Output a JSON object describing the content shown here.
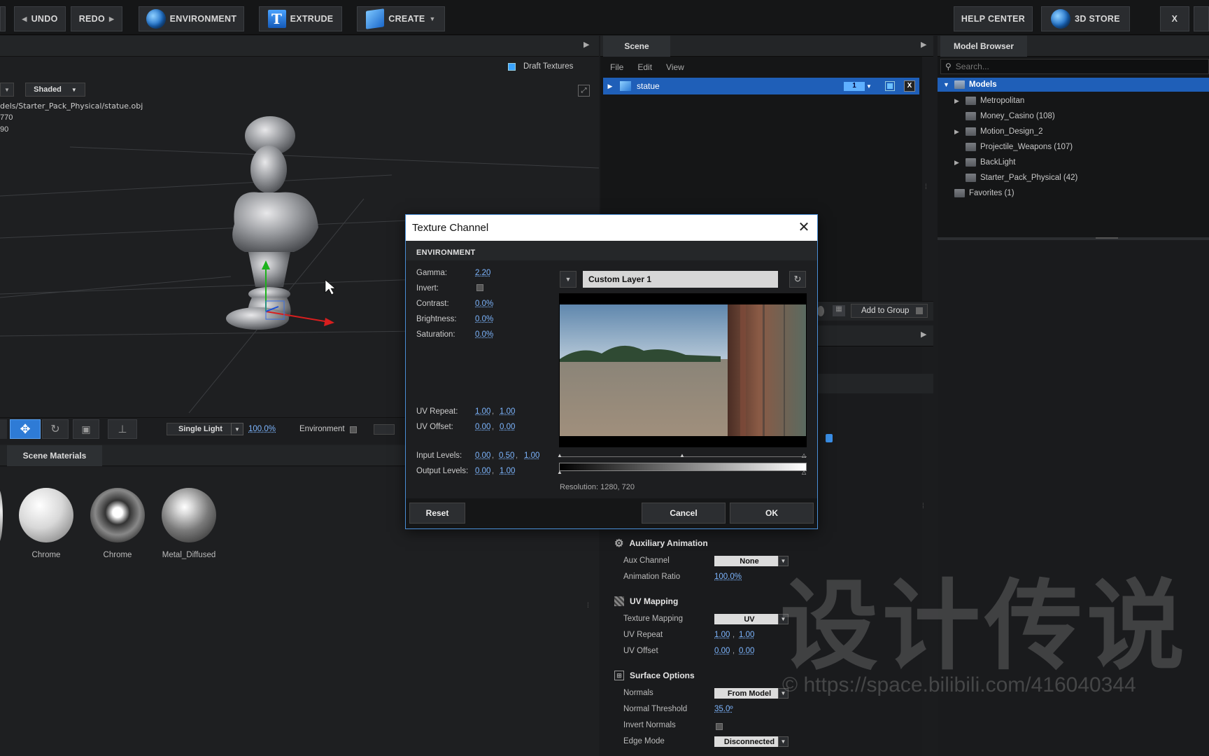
{
  "toolbar": {
    "undo": "UNDO",
    "redo": "REDO",
    "environment": "ENVIRONMENT",
    "extrude": "EXTRUDE",
    "create": "CREATE",
    "help_center": "HELP CENTER",
    "store": "3D STORE",
    "close": "X"
  },
  "viewport": {
    "draft_textures": "Draft Textures",
    "shading_mode": "Shaded",
    "file_path": "dels/Starter_Pack_Physical/statue.obj",
    "info_line1": "770",
    "info_line2": "90",
    "light_mode": "Single Light",
    "light_percent": "100.0%",
    "environment_label": "Environment"
  },
  "materials": {
    "tab": "Scene Materials",
    "items": [
      {
        "label": "Chrome"
      },
      {
        "label": "Chrome"
      },
      {
        "label": "Metal_Diffused"
      }
    ]
  },
  "scene": {
    "tab": "Scene",
    "menu": [
      "File",
      "Edit",
      "View"
    ],
    "object_name": "statue",
    "layer_number": "1",
    "add_to_group": "Add to Group"
  },
  "model_browser": {
    "tab": "Model Browser",
    "search_placeholder": "Search...",
    "root": "Models",
    "items": [
      {
        "label": "Metropolitan",
        "expandable": true
      },
      {
        "label": "Money_Casino (108)",
        "expandable": false
      },
      {
        "label": "Motion_Design_2",
        "expandable": true
      },
      {
        "label": "Projectile_Weapons (107)",
        "expandable": false
      },
      {
        "label": "BackLight",
        "expandable": true
      },
      {
        "label": "Starter_Pack_Physical (42)",
        "expandable": false
      }
    ],
    "favorites": "Favorites (1)"
  },
  "properties": {
    "aux_title": "Auxiliary Animation",
    "aux_channel_label": "Aux Channel",
    "aux_channel_value": "None",
    "anim_ratio_label": "Animation Ratio",
    "anim_ratio_value": "100.0%",
    "uv_title": "UV Mapping",
    "tex_mapping_label": "Texture Mapping",
    "tex_mapping_value": "UV",
    "uv_repeat_label": "UV Repeat",
    "uv_repeat_u": "1.00",
    "uv_repeat_v": "1.00",
    "uv_offset_label": "UV Offset",
    "uv_offset_u": "0.00",
    "uv_offset_v": "0.00",
    "surface_title": "Surface Options",
    "normals_label": "Normals",
    "normals_value": "From Model",
    "normal_threshold_label": "Normal Threshold",
    "normal_threshold_value": "35.0º",
    "invert_normals_label": "Invert Normals",
    "edge_mode_label": "Edge Mode",
    "edge_mode_value": "Disconnected"
  },
  "dialog": {
    "title": "Texture Channel",
    "section": "ENVIRONMENT",
    "gamma_label": "Gamma:",
    "gamma_value": "2.20",
    "invert_label": "Invert:",
    "contrast_label": "Contrast:",
    "contrast_value": "0.0%",
    "brightness_label": "Brightness:",
    "brightness_value": "0.0%",
    "saturation_label": "Saturation:",
    "saturation_value": "0.0%",
    "uv_repeat_label": "UV Repeat:",
    "uv_repeat_u": "1.00",
    "uv_repeat_v": "1.00",
    "uv_offset_label": "UV Offset:",
    "uv_offset_u": "0.00",
    "uv_offset_v": "0.00",
    "input_levels_label": "Input Levels:",
    "input_levels": [
      "0.00",
      "0.50",
      "1.00"
    ],
    "output_levels_label": "Output Levels:",
    "output_levels": [
      "0.00",
      "1.00"
    ],
    "layer_name": "Custom Layer 1",
    "resolution": "Resolution: 1280, 720",
    "reset": "Reset",
    "cancel": "Cancel",
    "ok": "OK"
  },
  "watermark": {
    "text": "设计传说",
    "url": "© https://space.bilibili.com/416040344"
  },
  "colors": {
    "accent": "#1f5fb8",
    "link": "#7db6ff"
  }
}
